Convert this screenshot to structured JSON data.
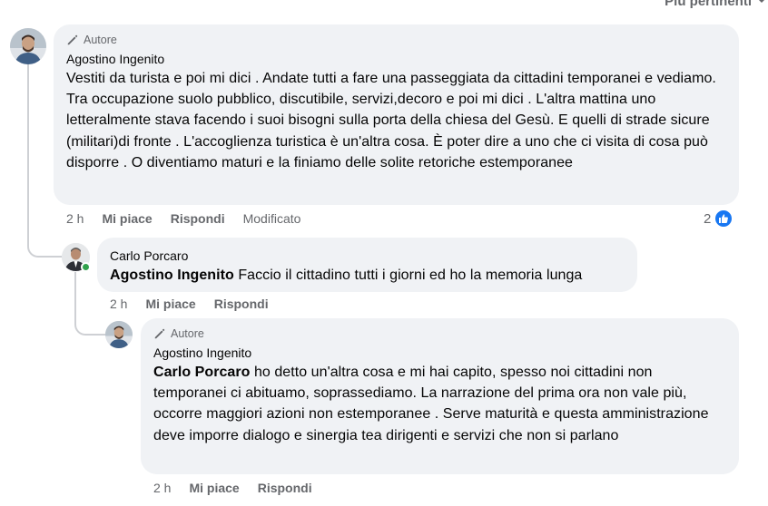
{
  "sort": {
    "label": "Più pertinenti",
    "icon": "chevron-down-icon"
  },
  "comments": [
    {
      "badge_icon": "pencil-icon",
      "badge": "Autore",
      "author": "Agostino Ingenito",
      "text": "Vestiti da turista e poi mi dici . Andate tutti a fare una passeggiata da cittadini temporanei e vediamo. Tra occupazione suolo pubblico, discutibile, servizi,decoro e poi mi dici . L'altra mattina uno letteralmente stava facendo i suoi bisogni sulla porta della chiesa del Gesù. E quelli di strade sicure (militari)di fronte . L'accoglienza turistica è un'altra cosa. È poter dire a uno che ci visita di cosa può disporre . O diventiamo maturi e la finiamo delle solite retoriche estemporanee",
      "time": "2 h",
      "like": "Mi piace",
      "reply": "Rispondi",
      "edited": "Modificato",
      "reaction_count": "2",
      "reaction_icon": "like-icon"
    },
    {
      "author": "Carlo Porcaro",
      "mention": "Agostino Ingenito",
      "text": " Faccio il cittadino tutti i giorni ed ho la memoria lunga",
      "time": "2 h",
      "like": "Mi piace",
      "reply": "Rispondi",
      "online": true
    },
    {
      "badge_icon": "pencil-icon",
      "badge": "Autore",
      "author": "Agostino Ingenito",
      "mention": "Carlo Porcaro",
      "text": " ho detto un'altra cosa e mi hai capito, spesso noi cittadini non temporanei ci abituamo, soprassediamo. La narrazione del prima ora non vale più, occorre maggiori azioni non estemporanee . Serve maturità e questa amministrazione deve imporre dialogo e sinergia tea dirigenti e servizi che non si parlano",
      "time": "2 h",
      "like": "Mi piace",
      "reply": "Rispondi"
    }
  ],
  "colors": {
    "bubble": "#f0f2f5",
    "meta": "#65676b",
    "text": "#050505",
    "like_blue": "#1877f2",
    "online_green": "#31a24c"
  }
}
